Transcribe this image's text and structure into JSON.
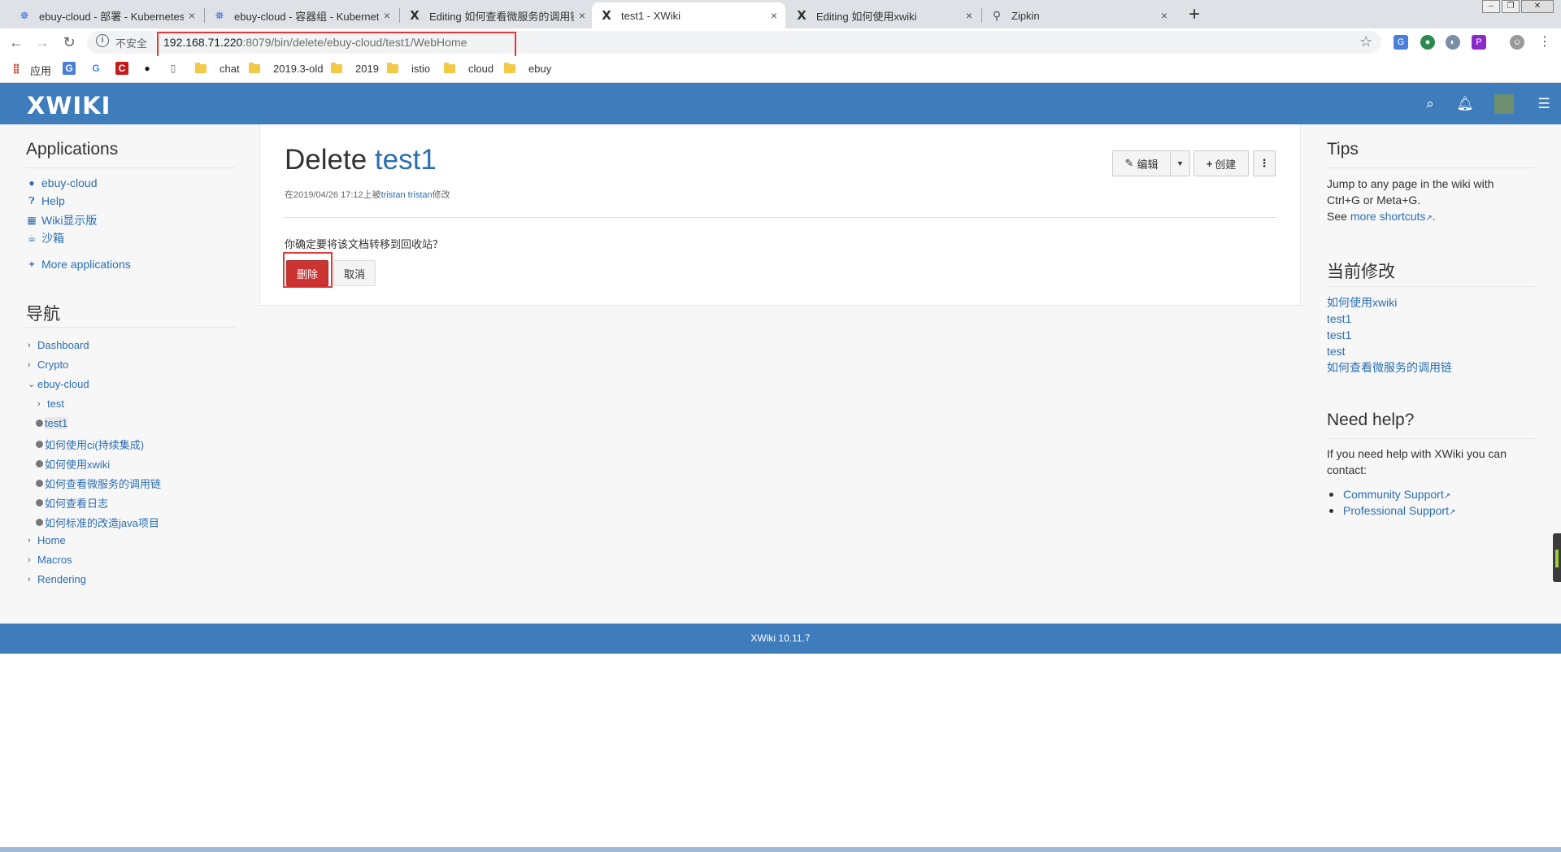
{
  "browser": {
    "tabs": [
      {
        "title": "ebuy-cloud - 部署 - Kubernetes",
        "icon": "kubernetes-icon"
      },
      {
        "title": "ebuy-cloud - 容器组 - Kubernetes",
        "icon": "kubernetes-icon"
      },
      {
        "title": "Editing 如何查看微服务的调用链",
        "icon": "xwiki-icon"
      },
      {
        "title": "test1 - XWiki",
        "icon": "xwiki-icon",
        "active": true
      },
      {
        "title": "Editing 如何使用xwiki",
        "icon": "xwiki-icon"
      },
      {
        "title": "Zipkin",
        "icon": "zipkin-icon"
      }
    ],
    "tab_close": "×",
    "new_tab": "+",
    "insecure_label": "不安全",
    "url_host": "192.168.71.220",
    "url_rest": ":8079/bin/delete/ebuy-cloud/test1/WebHome",
    "bookmarks": {
      "apps_label": "应用",
      "folders": [
        "chat",
        "2019.3-old",
        "2019",
        "istio",
        "cloud",
        "ebuy"
      ]
    }
  },
  "xwiki": {
    "logo": "XWIKI",
    "applications": {
      "title": "Applications",
      "items": [
        "ebuy-cloud",
        "Help",
        "Wiki显示版",
        "沙箱"
      ],
      "more": "More applications"
    },
    "navigation": {
      "title": "导航",
      "top_items": [
        "Dashboard",
        "Crypto",
        "ebuy-cloud"
      ],
      "children": [
        "test",
        "test1",
        "如何使用ci(持续集成)",
        "如何使用xwiki",
        "如何查看微服务的调用链",
        "如何查看日志",
        "如何标准的改造java项目"
      ],
      "bottom_items": [
        "Home",
        "Macros",
        "Rendering"
      ]
    },
    "page": {
      "title_prefix": "Delete",
      "title_name": "test1",
      "meta_prefix": "在2019/04/26 17:12上被",
      "meta_author": "tristan tristan",
      "meta_suffix": "修改",
      "edit_label": "编辑",
      "create_label": "创建",
      "confirm_text": "你确定要将该文档转移到回收站？",
      "delete_label": "删除",
      "cancel_label": "取消"
    },
    "tips": {
      "title": "Tips",
      "line1": "Jump to any page in the wiki with",
      "line2": "Ctrl+G or Meta+G.",
      "see": "See ",
      "shortcuts_link": "more shortcuts",
      "period": "."
    },
    "recent": {
      "title": "当前修改",
      "items": [
        "如何使用xwiki",
        "test1",
        "test1",
        "test",
        "如何查看微服务的调用链"
      ]
    },
    "help": {
      "title": "Need help?",
      "line1": "If you need help with XWiki you can",
      "line2": "contact:",
      "links": [
        "Community Support",
        "Professional Support"
      ]
    },
    "footer": "XWiki 10.11.7"
  },
  "colors": {
    "brand": "#3e7cbc",
    "link": "#2a6eb1",
    "danger": "#cc3333",
    "highlight": "#e03a3a"
  }
}
